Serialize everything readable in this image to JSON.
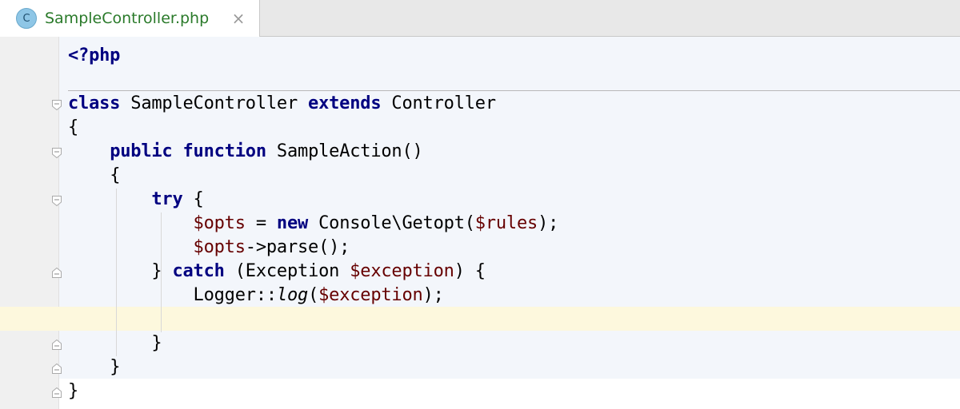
{
  "tab": {
    "icon_letter": "C",
    "title": "SampleController.php",
    "close": "×"
  },
  "code": {
    "line1": {
      "kw": "<?php"
    },
    "line2": {
      "kw1": "class",
      "t1": " SampleController ",
      "kw2": "extends",
      "t2": " Controller"
    },
    "line3": {
      "t": "{"
    },
    "line4": {
      "indent": "    ",
      "kw1": "public",
      "s": " ",
      "kw2": "function",
      "t": " SampleAction()"
    },
    "line5": {
      "indent": "    ",
      "t": "{"
    },
    "line6": {
      "indent": "        ",
      "kw": "try",
      "t": " {"
    },
    "line7": {
      "indent": "            ",
      "v1": "$opts",
      "t1": " = ",
      "kw": "new",
      "t2": " Console\\Getopt(",
      "v2": "$rules",
      "t3": ");"
    },
    "line8": {
      "indent": "            ",
      "v1": "$opts",
      "t1": "->parse();"
    },
    "line9": {
      "indent": "        ",
      "t1": "} ",
      "kw": "catch",
      "t2": " (Exception ",
      "v1": "$exception",
      "t3": ") {"
    },
    "line10": {
      "indent": "            ",
      "t1": "Logger::",
      "it": "log",
      "t2": "(",
      "v1": "$exception",
      "t3": ");"
    },
    "line12": {
      "indent": "        ",
      "t": "}"
    },
    "line13": {
      "indent": "    ",
      "t": "}"
    },
    "line14": {
      "t": "}"
    }
  },
  "colors": {
    "keyword": "#000080",
    "variable": "#660000",
    "tab_title": "#2a7a2a",
    "caret_line": "#fdf8dd"
  }
}
